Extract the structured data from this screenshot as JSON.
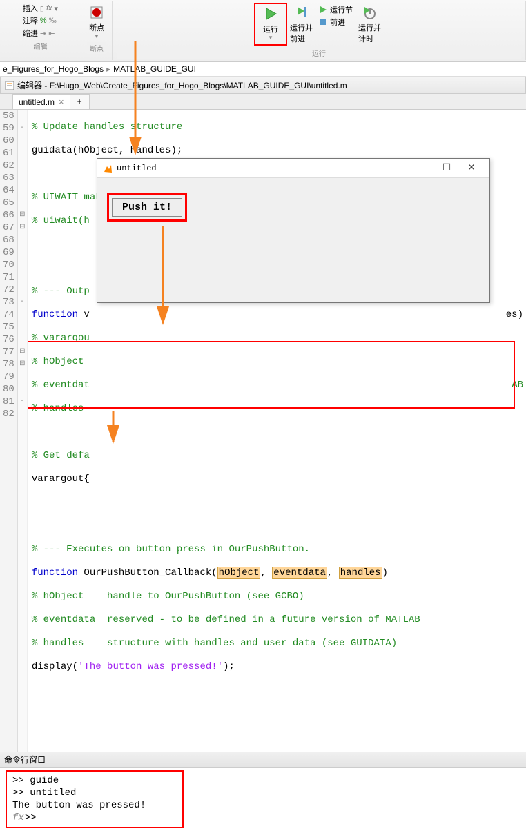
{
  "toolbar": {
    "insert": "插入",
    "comment": "注释",
    "indent": "缩进",
    "breakpoints": "断点",
    "run": "运行",
    "run_advance": "运行并\n前进",
    "run_section": "运行节",
    "advance": "前进",
    "run_time": "运行并\n计时",
    "group_edit": "编辑",
    "group_bp": "断点",
    "group_run": "运行"
  },
  "breadcrumb": {
    "p1": "e_Figures_for_Hogo_Blogs",
    "p2": "MATLAB_GUIDE_GUI"
  },
  "editor": {
    "title_prefix": "编辑器",
    "path": "F:\\Hugo_Web\\Create_Figures_for_Hogo_Blogs\\MATLAB_GUIDE_GUI\\untitled.m",
    "tab": "untitled.m"
  },
  "code": {
    "l58": "% Update handles structure",
    "l59a": "guidata(hObject, handles);",
    "l61": "% UIWAIT makes untitled wait for user response (see UIRESUME)",
    "l62": "% uiwait(h",
    "l65": "% --- Outp",
    "l66k": "function",
    "l66r": " v",
    "l66tail": "es)",
    "l67": "% varargou",
    "l68": "% hObject",
    "l69": "% eventdat",
    "l69tail": "AB",
    "l70": "% handles",
    "l72": "% Get defa",
    "l73": "varargout{",
    "l76": "% --- Executes on button press in OurPushButton.",
    "l77k": "function",
    "l77fn": " OurPushButton_Callback(",
    "l77a1": "hObject",
    "l77s1": ", ",
    "l77a2": "eventdata",
    "l77s2": ", ",
    "l77a3": "handles",
    "l77e": ")",
    "l78": "% hObject    handle to OurPushButton (see GCBO)",
    "l79": "% eventdata  reserved - to be defined in a future version of MATLAB",
    "l80": "% handles    structure with handles and user data (see GUIDATA)",
    "l81a": "display(",
    "l81b": "'The button was pressed!'",
    "l81c": ");"
  },
  "gui": {
    "title": "untitled",
    "button": "Push it!"
  },
  "cmd": {
    "title": "命令行窗口",
    "l1": ">> guide",
    "l2": ">> untitled",
    "l3": "The button was pressed!",
    "l4": ">>"
  },
  "lines": [
    "58",
    "59",
    "60",
    "61",
    "62",
    "63",
    "64",
    "65",
    "66",
    "67",
    "68",
    "69",
    "70",
    "71",
    "72",
    "73",
    "74",
    "75",
    "76",
    "77",
    "78",
    "79",
    "80",
    "81",
    "82"
  ]
}
